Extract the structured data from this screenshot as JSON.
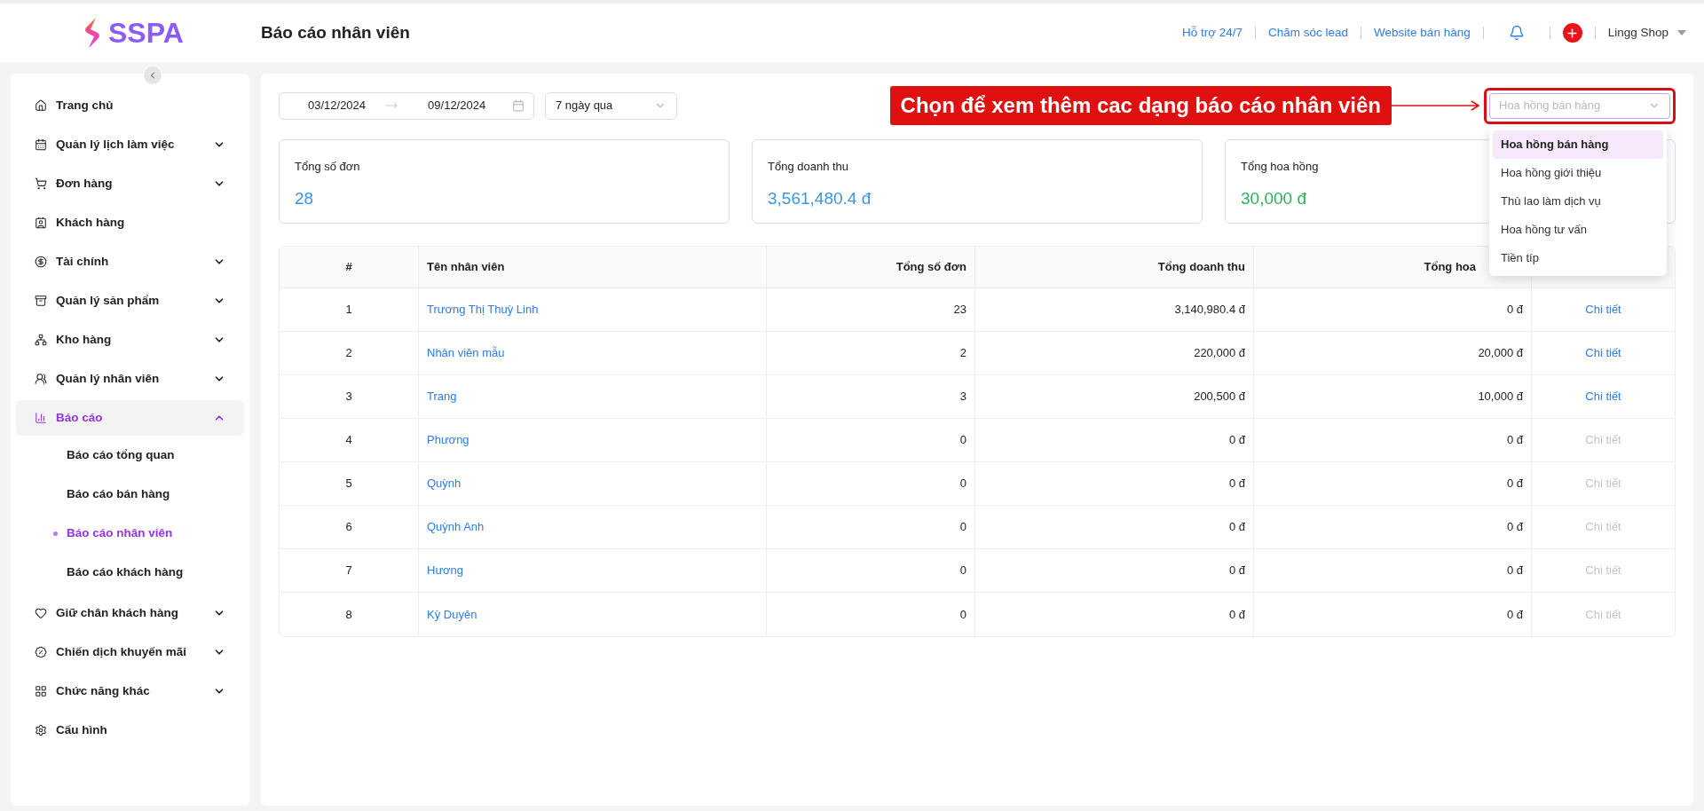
{
  "brand": {
    "name": "SSPA"
  },
  "header": {
    "title": "Báo cáo nhân viên",
    "links": [
      "Hỗ trợ 24/7",
      "Chăm sóc lead",
      "Website bán hàng"
    ],
    "account": "Lingg Shop"
  },
  "sidebar": {
    "items": [
      {
        "label": "Trang chủ",
        "kind": "link",
        "selected": false
      },
      {
        "label": "Quản lý lịch làm việc",
        "kind": "group",
        "expanded": false,
        "selected": false
      },
      {
        "label": "Đơn hàng",
        "kind": "group",
        "expanded": false,
        "selected": false
      },
      {
        "label": "Khách hàng",
        "kind": "link",
        "selected": false
      },
      {
        "label": "Tài chính",
        "kind": "group",
        "expanded": false,
        "selected": false
      },
      {
        "label": "Quản lý sản phẩm",
        "kind": "group",
        "expanded": false,
        "selected": false
      },
      {
        "label": "Kho hàng",
        "kind": "group",
        "expanded": false,
        "selected": false
      },
      {
        "label": "Quản lý nhân viên",
        "kind": "group",
        "expanded": false,
        "selected": false
      },
      {
        "label": "Báo cáo",
        "kind": "group",
        "expanded": true,
        "selected": true,
        "children": [
          {
            "label": "Báo cáo tổng quan",
            "selected": false
          },
          {
            "label": "Báo cáo bán hàng",
            "selected": false
          },
          {
            "label": "Báo cáo nhân viên",
            "selected": true
          },
          {
            "label": "Báo cáo khách hàng",
            "selected": false
          }
        ]
      },
      {
        "label": "Giữ chân khách hàng",
        "kind": "group",
        "expanded": false,
        "selected": false
      },
      {
        "label": "Chiến dịch khuyến mãi",
        "kind": "group",
        "expanded": false,
        "selected": false
      },
      {
        "label": "Chức năng khác",
        "kind": "group",
        "expanded": false,
        "selected": false
      },
      {
        "label": "Cấu hình",
        "kind": "link",
        "selected": false
      }
    ]
  },
  "filters": {
    "date_from": "03/12/2024",
    "date_to": "09/12/2024",
    "range": "7 ngày qua"
  },
  "annotation": {
    "text": "Chọn để xem thêm cac dạng báo cáo nhân viên"
  },
  "report_select": {
    "placeholder": "Hoa hồng bán hàng",
    "options": [
      {
        "label": "Hoa hồng bán hàng",
        "selected": true
      },
      {
        "label": "Hoa hồng giới thiệu",
        "selected": false
      },
      {
        "label": "Thù lao làm dịch vụ",
        "selected": false
      },
      {
        "label": "Hoa hồng tư vấn",
        "selected": false
      },
      {
        "label": "Tiền típ",
        "selected": false
      }
    ]
  },
  "stats": [
    {
      "label": "Tổng số đơn",
      "value": "28",
      "color": "#3b95e0"
    },
    {
      "label": "Tổng doanh thu",
      "value": "3,561,480.4 đ",
      "color": "#3b95e0"
    },
    {
      "label": "Tổng hoa hồng",
      "value": "30,000 đ",
      "color": "#2fae5f"
    }
  ],
  "table": {
    "columns": [
      "#",
      "Tên nhân viên",
      "Tổng số đơn",
      "Tổng doanh thu",
      "Tổng hoa"
    ],
    "rows": [
      {
        "index": "1",
        "name": "Trương Thị Thuỳ Linh",
        "orders": "23",
        "revenue": "3,140,980.4 đ",
        "commission": "0 đ",
        "action": "Chi tiết",
        "disabled": false
      },
      {
        "index": "2",
        "name": "Nhân viên mẫu",
        "orders": "2",
        "revenue": "220,000 đ",
        "commission": "20,000 đ",
        "action": "Chi tiết",
        "disabled": false
      },
      {
        "index": "3",
        "name": "Trang",
        "orders": "3",
        "revenue": "200,500 đ",
        "commission": "10,000 đ",
        "action": "Chi tiết",
        "disabled": false
      },
      {
        "index": "4",
        "name": "Phương",
        "orders": "0",
        "revenue": "0 đ",
        "commission": "0 đ",
        "action": "Chi tiết",
        "disabled": true
      },
      {
        "index": "5",
        "name": "Quỳnh",
        "orders": "0",
        "revenue": "0 đ",
        "commission": "0 đ",
        "action": "Chi tiết",
        "disabled": true
      },
      {
        "index": "6",
        "name": "Quỳnh Anh",
        "orders": "0",
        "revenue": "0 đ",
        "commission": "0 đ",
        "action": "Chi tiết",
        "disabled": true
      },
      {
        "index": "7",
        "name": "Hương",
        "orders": "0",
        "revenue": "0 đ",
        "commission": "0 đ",
        "action": "Chi tiết",
        "disabled": true
      },
      {
        "index": "8",
        "name": "Kỳ Duyên",
        "orders": "0",
        "revenue": "0 đ",
        "commission": "0 đ",
        "action": "Chi tiết",
        "disabled": true
      }
    ]
  }
}
